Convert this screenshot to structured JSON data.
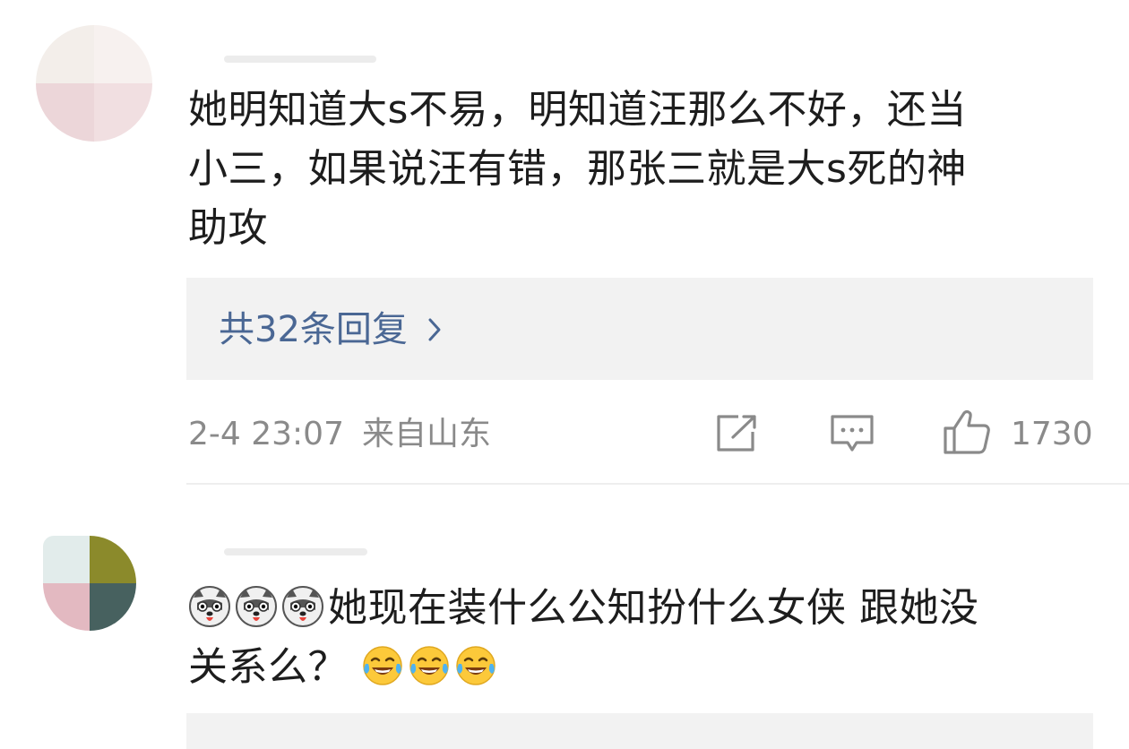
{
  "comments": [
    {
      "text_lines": [
        "她明知道大s不易，明知道汪那么不好，还当",
        "小三，如果说汪有错，那张三就是大s死的神",
        "助攻"
      ],
      "replies_label": "共32条回复",
      "timestamp": "2-4 23:07",
      "location": "来自山东",
      "like_count": "1730"
    },
    {
      "lead_emojis": [
        "husky-emoji",
        "husky-emoji",
        "husky-emoji"
      ],
      "text_line1": "她现在装什么公知扮什么女侠 跟她没",
      "text_line2": "关系么？",
      "trail_emojis": [
        "laugh-cry-emoji",
        "laugh-cry-emoji",
        "laugh-cry-emoji"
      ]
    }
  ],
  "icons": {
    "share": "share-icon",
    "comment": "comment-icon",
    "like": "thumbs-up-icon",
    "chevron": "chevron-right-icon"
  },
  "colors": {
    "link": "#4a6794",
    "meta": "#8a8a8a",
    "reply_bg": "#f2f2f2"
  }
}
